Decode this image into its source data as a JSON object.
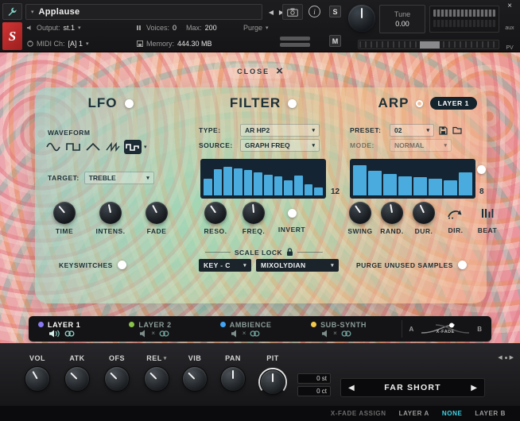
{
  "glyphs": {
    "dropdown": "▾",
    "left": "◀",
    "right": "▶",
    "close": "×",
    "mute": "×"
  },
  "header": {
    "instrument_name": "Applause",
    "output_label": "Output:",
    "output_value": "st.1",
    "voices_label": "Voices:",
    "voices_value": "0",
    "max_label": "Max:",
    "max_value": "200",
    "purge_label": "Purge",
    "midi_label": "MIDI Ch:",
    "midi_value": "[A] 1",
    "memory_label": "Memory:",
    "memory_value": "444.30 MB",
    "solo_label": "S",
    "mute_label": "M",
    "tune_label": "Tune",
    "tune_value": "0.00",
    "aux_label": "aux",
    "pv_label": "PV",
    "logo_letter": "S"
  },
  "overlay": {
    "close_label": "CLOSE",
    "layer_badge": "LAYER 1"
  },
  "lfo": {
    "title": "LFO",
    "waveform_label": "WAVEFORM",
    "target_label": "TARGET:",
    "target_value": "TREBLE",
    "knobs": [
      "TIME",
      "INTENS.",
      "FADE"
    ],
    "keyswitches_label": "KEYSWITCHES"
  },
  "filter": {
    "title": "FILTER",
    "type_label": "TYPE:",
    "type_value": "AR HP2",
    "source_label": "SOURCE:",
    "source_value": "GRAPH FREQ",
    "steps_label": "12",
    "knob1": "RESO.",
    "knob2": "FREQ.",
    "invert_label": "INVERT",
    "scale_lock_label": "SCALE LOCK",
    "key_value": "KEY - C",
    "scale_value": "MIXOLYDIAN",
    "bars": [
      50,
      78,
      85,
      80,
      76,
      70,
      63,
      57,
      45,
      60,
      34,
      24
    ]
  },
  "arp": {
    "title": "ARP",
    "preset_label": "PRESET:",
    "preset_value": "02",
    "mode_label": "MODE:",
    "mode_value": "NORMAL",
    "steps_label": "8",
    "knob1": "SWING",
    "knob2": "RAND.",
    "knob3": "DUR.",
    "dir_label": "DIR.",
    "beat_label": "BEAT",
    "purge_samples_label": "PURGE UNUSED SAMPLES",
    "bars": [
      90,
      74,
      64,
      58,
      55,
      50,
      46,
      68
    ]
  },
  "layers": {
    "items": [
      {
        "name": "LAYER 1",
        "dot": "#8a7bf4"
      },
      {
        "name": "LAYER 2",
        "dot": "#8bc34a"
      },
      {
        "name": "AMBIENCE",
        "dot": "#42a5f5"
      },
      {
        "name": "SUB-SYNTH",
        "dot": "#f2c94c"
      }
    ],
    "xfade_a": "A",
    "xfade_b": "B",
    "xfade_label": "X-FADE"
  },
  "bottom": {
    "knobs": [
      "VOL",
      "ATK",
      "OFS",
      "REL",
      "VIB",
      "PAN",
      "PIT"
    ],
    "pitch_semitones": "0 st",
    "pitch_cents": "0 ct",
    "articulation": "FAR SHORT",
    "assign_label": "X-FADE ASSIGN",
    "assign_options": [
      "LAYER A",
      "NONE",
      "LAYER B"
    ],
    "assign_selected": "NONE"
  },
  "colors": {
    "accent_cyan": "#3fd4e6",
    "bar_blue": "#4aabdf"
  }
}
